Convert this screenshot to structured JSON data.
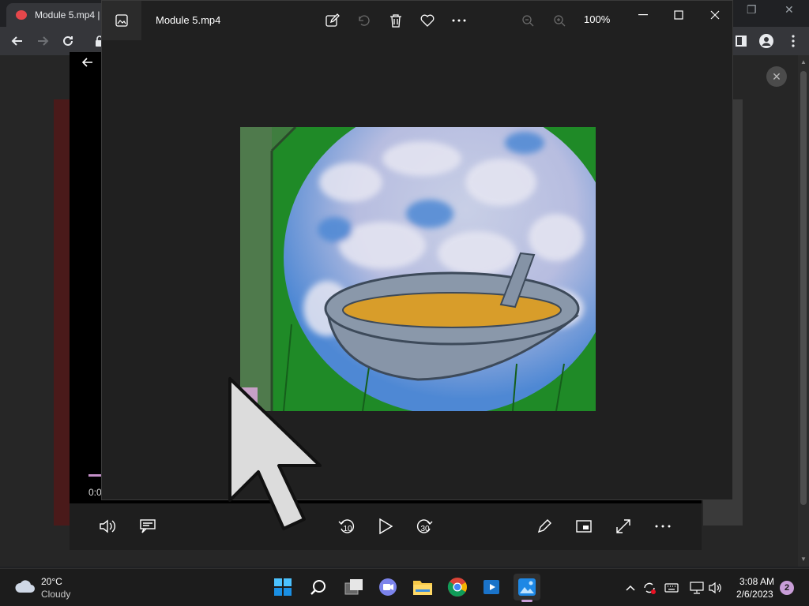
{
  "browser": {
    "tab_title": "Module 5.mp4 |",
    "toolbar_icons": [
      "back-arrow-icon",
      "forward-arrow-icon",
      "reload-icon",
      "lock-icon",
      "sidebar-icon",
      "profile-icon",
      "menu-icon"
    ]
  },
  "video_player": {
    "time_label": "0:0",
    "progress_fraction": 0.02
  },
  "photos": {
    "title": "Module 5.mp4",
    "zoom": "100%",
    "tools": [
      "edit-image-icon",
      "rotate-icon",
      "delete-icon",
      "favorite-icon",
      "more-icon",
      "zoom-out-icon",
      "zoom-in-icon"
    ]
  },
  "player_controls": {
    "skip_back_label": "10",
    "skip_forward_label": "30"
  },
  "taskbar": {
    "weather_temp": "20°C",
    "weather_desc": "Cloudy",
    "time": "3:08 AM",
    "date": "2/6/2023",
    "notification_count": "2"
  },
  "colors": {
    "accent": "#c38fc8",
    "window_bg": "#202020",
    "badge": "#c99ed8"
  }
}
